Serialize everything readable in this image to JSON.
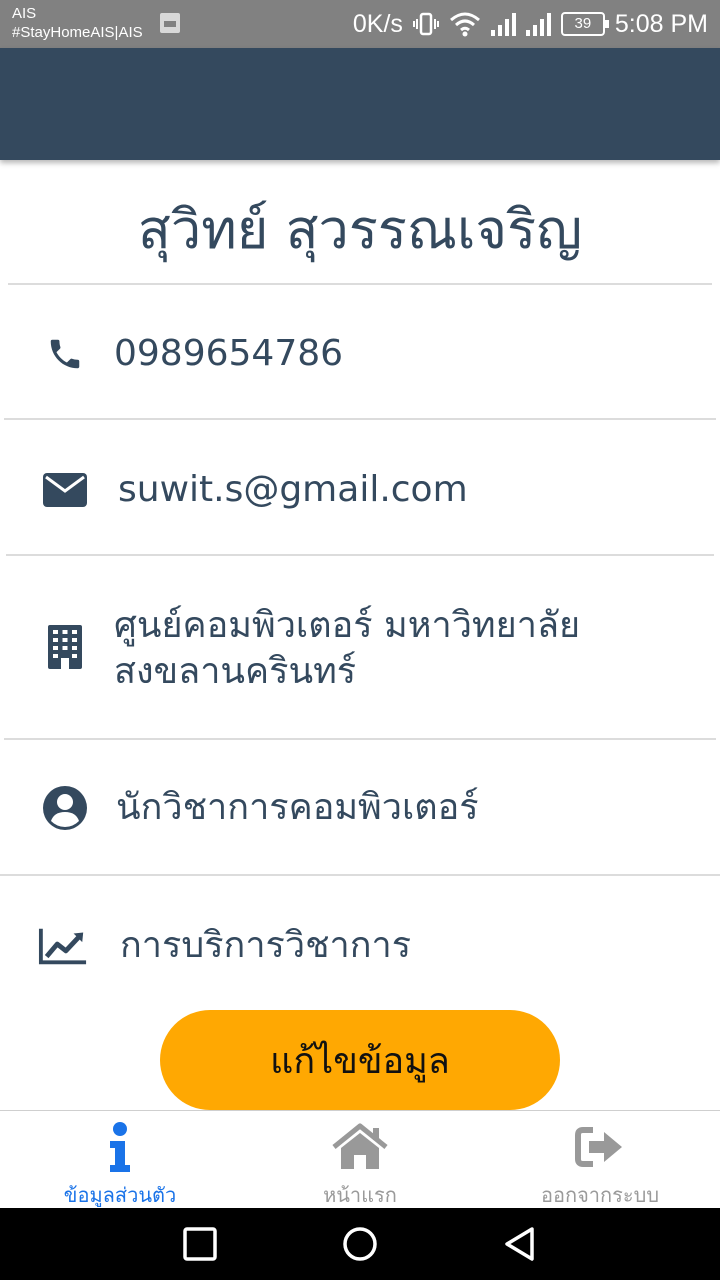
{
  "status_bar": {
    "carrier_line1": "AIS",
    "carrier_line2": "#StayHomeAIS|AIS",
    "speed": "0K/s",
    "battery": "39",
    "time": "5:08 PM"
  },
  "profile": {
    "name": "สุวิทย์  สุวรรณเจริญ",
    "phone": "0989654786",
    "email": "suwit.s@gmail.com",
    "org_line1": "ศูนย์คอมพิวเตอร์ มหาวิทยาลัย",
    "org_line2": "สงขลานครินทร์",
    "position": "นักวิชาการคอมพิวเตอร์",
    "department": "การบริการวิชาการ"
  },
  "actions": {
    "edit_label": "แก้ไขข้อมูล"
  },
  "bottom_nav": {
    "items": [
      {
        "label": "ข้อมูลส่วนตัว",
        "icon": "info-icon",
        "active": true
      },
      {
        "label": "หน้าแรก",
        "icon": "home-icon",
        "active": false
      },
      {
        "label": "ออกจากระบบ",
        "icon": "sign-out-icon",
        "active": false
      }
    ]
  },
  "colors": {
    "primary": "#34495e",
    "accent": "#ffa802",
    "active_nav": "#1a73e8",
    "inactive_nav": "#9a9a9a"
  }
}
